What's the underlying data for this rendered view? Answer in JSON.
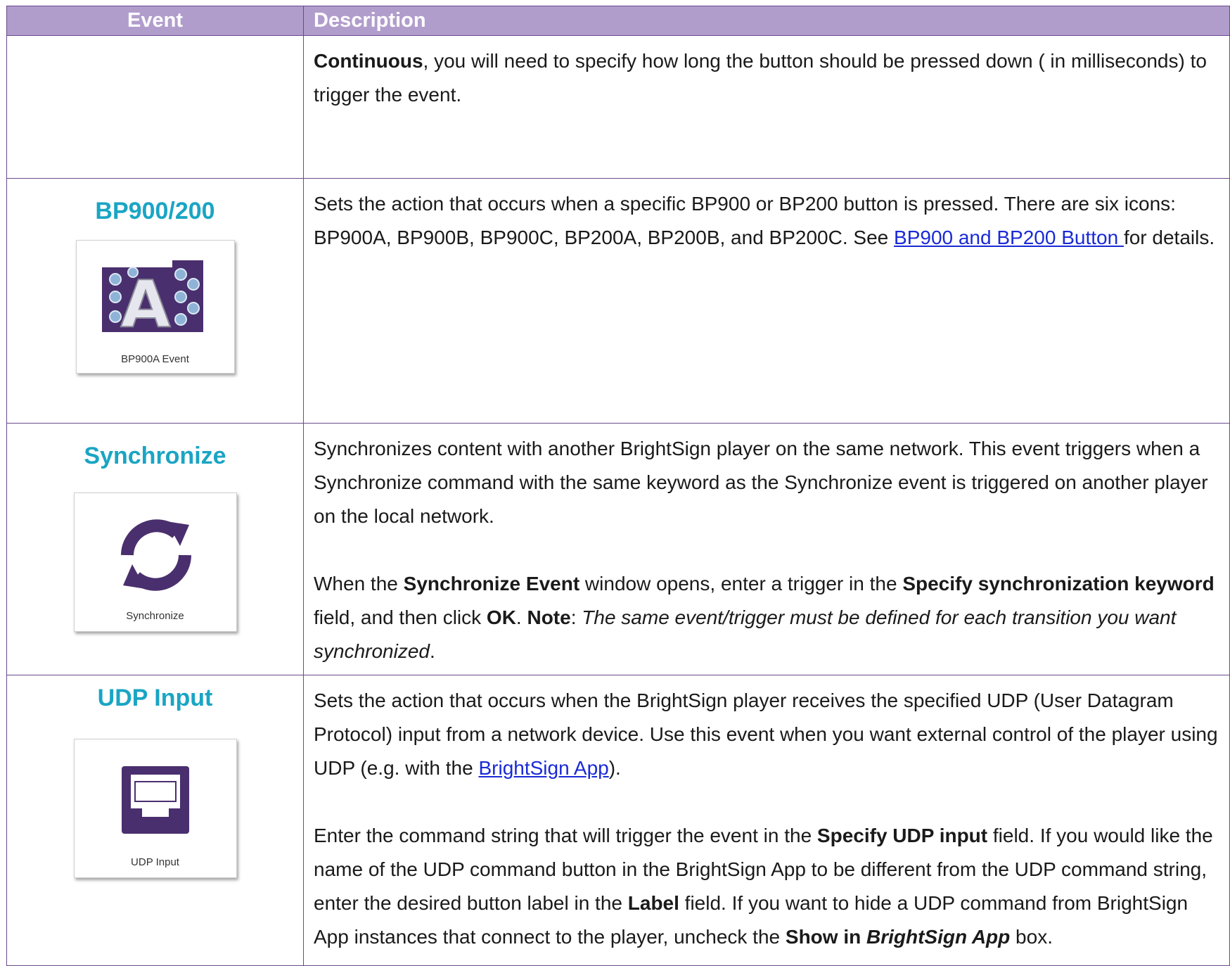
{
  "table": {
    "headers": {
      "event": "Event",
      "description": "Description"
    },
    "continued_row": {
      "bold_lead": "Continuous",
      "text": ", you will need to specify how long the button should be pressed down ( in milliseconds) to trigger the event."
    },
    "bp900": {
      "title": "BP900/200",
      "icon_caption": "BP900A Event",
      "icon_letter": "A",
      "desc_text": "Sets the action that occurs when a specific BP900 or BP200 button is pressed. There are six icons: BP900A, BP900B, BP900C, BP200A, BP200B, and BP200C. See ",
      "desc_link": "BP900 and BP200 Button ",
      "desc_tail": " for details."
    },
    "synchronize": {
      "title": "Synchronize",
      "icon_caption": "Synchronize",
      "p1": "Synchronizes content with another BrightSign player on the same network. This event triggers when a Synchronize command with the same keyword as the Synchronize event is triggered on another player on the local network.",
      "p2_a": "When the ",
      "p2_b1": "Synchronize Event",
      "p2_c": " window opens, enter a trigger in the ",
      "p2_b2": "Specify synchronization keyword",
      "p2_d": " field, and then click ",
      "p2_b3": "OK",
      "p2_e": ". ",
      "p2_b4": "Note",
      "p2_f": ": ",
      "p2_i": "The same event/trigger must be defined for each transition you want synchronized",
      "p2_g": "."
    },
    "udp": {
      "title": "UDP Input",
      "icon_caption": "UDP Input",
      "p1_a": "Sets the action that occurs when the BrightSign player receives the specified UDP (User Datagram Protocol) input from a network device. Use this event when you want external control of the player using UDP (e.g. with the ",
      "p1_link": "BrightSign App",
      "p1_b": ").",
      "p2_a": "Enter the command string that will trigger the event in the ",
      "p2_b1": "Specify UDP input",
      "p2_c": " field. If you would like the name of the UDP command button in the BrightSign App to be different from the UDP command string, enter the desired button label in the ",
      "p2_b2": "Label",
      "p2_d": " field. If you want to hide a UDP command from BrightSign App instances that connect to the player, uncheck the ",
      "p2_b3": "Show in ",
      "p2_bi": "BrightSign App",
      "p2_e": " box."
    }
  },
  "colors": {
    "header_bg": "#b19dcc",
    "title": "#1aa5c4",
    "border": "#6a4a8c",
    "icon_purple": "#4a2f6e",
    "link": "#1a2ad6"
  }
}
